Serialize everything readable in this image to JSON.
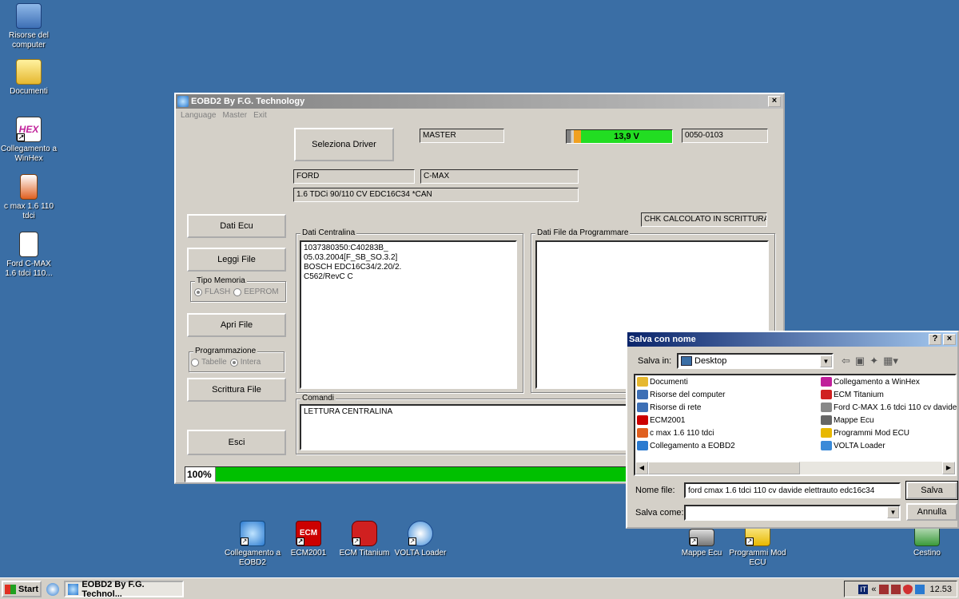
{
  "desktop": {
    "left_icons": [
      {
        "label": "Risorse del computer",
        "icon": "computer-icon"
      },
      {
        "label": "Documenti",
        "icon": "folder-icon"
      },
      {
        "label": "Collegamento a WinHex",
        "icon": "hex-icon"
      },
      {
        "label": "c max 1.6 110 tdci",
        "icon": "archive-icon"
      },
      {
        "label": "Ford C-MAX 1.6 tdci 110...",
        "icon": "document-icon"
      }
    ],
    "bottom_icons": [
      {
        "label": "Collegamento a EOBD2",
        "icon": "eobd2-icon"
      },
      {
        "label": "ECM2001",
        "icon": "ecm2001-icon"
      },
      {
        "label": "ECM Titanium",
        "icon": "ecm-titanium-icon"
      },
      {
        "label": "VOLTA Loader",
        "icon": "volta-icon"
      },
      {
        "label": "Mappe Ecu",
        "icon": "mappe-icon"
      },
      {
        "label": "Programmi Mod ECU",
        "icon": "programmi-icon"
      },
      {
        "label": "Cestino",
        "icon": "recycle-bin-icon"
      }
    ]
  },
  "app": {
    "title": "EOBD2 By F.G. Technology",
    "close": "×",
    "menu": [
      "Language",
      "Master",
      "Exit"
    ],
    "seleziona_driver": "Seleziona Driver",
    "master": "MASTER",
    "voltage": "13,9 V",
    "version": "0050-0103",
    "brand": "FORD",
    "model": "C-MAX",
    "engine": "1.6 TDCi  90/110 CV  EDC16C34 *CAN",
    "chk": "CHK CALCOLATO IN SCRITTURA",
    "buttons": {
      "dati_ecu": "Dati Ecu",
      "leggi_file": "Leggi File",
      "apri_file": "Apri File",
      "scrittura_file": "Scrittura File",
      "esci": "Esci"
    },
    "tipo_memoria": {
      "label": "Tipo Memoria",
      "flash": "FLASH",
      "eeprom": "EEPROM"
    },
    "programmazione": {
      "label": "Programmazione",
      "tabelle": "Tabelle",
      "intera": "Intera"
    },
    "dati_centralina": {
      "label": "Dati Centralina",
      "lines": [
        "1037380350:C40283B_",
        "05.03.2004[F_SB_SO.3.2]",
        "BOSCH EDC16C34/2.20/2.",
        "C562/RevC C"
      ]
    },
    "dati_file_label": "Dati File da Programmare",
    "comandi": {
      "label": "Comandi",
      "text": "LETTURA CENTRALINA"
    },
    "progress": {
      "label": "100%",
      "value": 1.0,
      "color": "#00c000"
    }
  },
  "dialog": {
    "title": "Salva con nome",
    "help": "?",
    "close": "×",
    "salva_in_label": "Salva in:",
    "salva_in_value": "Desktop",
    "items_left": [
      "Documenti",
      "Risorse del computer",
      "Risorse di rete",
      "ECM2001",
      "c max 1.6 110 tdci",
      "Collegamento a EOBD2"
    ],
    "items_right": [
      "Collegamento a WinHex",
      "ECM Titanium",
      "Ford C-MAX 1.6 tdci 110 cv davide",
      "Mappe Ecu",
      "Programmi Mod ECU",
      "VOLTA Loader"
    ],
    "nome_file_label": "Nome file:",
    "nome_file_value": "ford cmax 1.6 tdci 110 cv davide elettrauto edc16c34",
    "salva_come_label": "Salva come:",
    "salva_come_value": "",
    "salva": "Salva",
    "annulla": "Annulla"
  },
  "taskbar": {
    "start": "Start",
    "task": "EOBD2 By F.G. Technol...",
    "lang": "IT",
    "clock": "12.53"
  }
}
